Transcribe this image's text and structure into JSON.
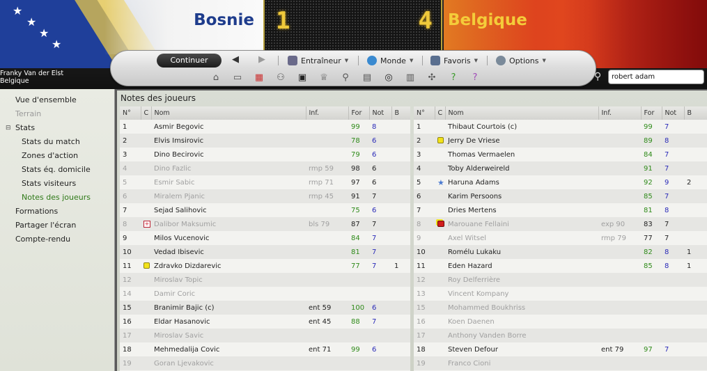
{
  "header": {
    "home_team": "Bosnie",
    "away_team": "Belgique",
    "home_score": "1",
    "away_score": "4",
    "manager_name": "Franky Van der Elst",
    "manager_nation": "Belgique"
  },
  "toolbar": {
    "continue_label": "Continuer",
    "menus": [
      "Entraîneur",
      "Monde",
      "Favoris",
      "Options"
    ],
    "icons": [
      "home-icon",
      "inbox-icon",
      "calendar-icon",
      "squad-icon",
      "tactics-icon",
      "trophy-icon",
      "scouting-icon",
      "notepad-icon",
      "binoculars-icon",
      "news-icon",
      "network-icon",
      "help-icon",
      "question-icon"
    ]
  },
  "search": {
    "value": "robert adam"
  },
  "sidebar": {
    "items": [
      {
        "label": "Vue d'ensemble",
        "level": 1,
        "state": "normal"
      },
      {
        "label": "Terrain",
        "level": 1,
        "state": "disabled"
      },
      {
        "label": "Stats",
        "level": 1,
        "state": "normal",
        "tree": "⊟"
      },
      {
        "label": "Stats du match",
        "level": 2,
        "state": "normal"
      },
      {
        "label": "Zones d'action",
        "level": 2,
        "state": "normal"
      },
      {
        "label": "Stats éq. domicile",
        "level": 2,
        "state": "normal"
      },
      {
        "label": "Stats visiteurs",
        "level": 2,
        "state": "normal"
      },
      {
        "label": "Notes des joueurs",
        "level": 2,
        "state": "active"
      },
      {
        "label": "Formations",
        "level": 1,
        "state": "normal"
      },
      {
        "label": "Partager l'écran",
        "level": 1,
        "state": "normal"
      },
      {
        "label": "Compte-rendu",
        "level": 1,
        "state": "normal"
      }
    ]
  },
  "main": {
    "title": "Notes des joueurs",
    "columns": [
      "N°",
      "C",
      "Nom",
      "Inf.",
      "For",
      "Not",
      "B"
    ],
    "home_players": [
      {
        "no": "1",
        "c": "",
        "name": "Asmir Begovic",
        "inf": "",
        "for": "99",
        "not": "8",
        "b": "",
        "sub": false
      },
      {
        "no": "2",
        "c": "",
        "name": "Elvis Imsirovic",
        "inf": "",
        "for": "78",
        "not": "6",
        "b": "",
        "sub": false
      },
      {
        "no": "3",
        "c": "",
        "name": "Dino Becirovic",
        "inf": "",
        "for": "79",
        "not": "6",
        "b": "",
        "sub": false
      },
      {
        "no": "4",
        "c": "",
        "name": "Dino Fazlic",
        "inf": "rmp 59",
        "for": "98",
        "not": "6",
        "b": "",
        "sub": true
      },
      {
        "no": "5",
        "c": "",
        "name": "Esmir Sabic",
        "inf": "rmp 71",
        "for": "97",
        "not": "6",
        "b": "",
        "sub": true
      },
      {
        "no": "6",
        "c": "",
        "name": "Miralem Pjanic",
        "inf": "rmp 45",
        "for": "91",
        "not": "7",
        "b": "",
        "sub": true
      },
      {
        "no": "7",
        "c": "",
        "name": "Sejad Salihovic",
        "inf": "",
        "for": "75",
        "not": "6",
        "b": "",
        "sub": false
      },
      {
        "no": "8",
        "c": "injury",
        "name": "Dalibor Maksumic",
        "inf": "bls 79",
        "for": "87",
        "not": "7",
        "b": "",
        "sub": true
      },
      {
        "no": "9",
        "c": "",
        "name": "Milos Vucenovic",
        "inf": "",
        "for": "84",
        "not": "7",
        "b": "",
        "sub": false
      },
      {
        "no": "10",
        "c": "",
        "name": "Vedad Ibisevic",
        "inf": "",
        "for": "81",
        "not": "7",
        "b": "",
        "sub": false
      },
      {
        "no": "11",
        "c": "yellow",
        "name": "Zdravko Dizdarevic",
        "inf": "",
        "for": "77",
        "not": "7",
        "b": "1",
        "sub": false
      },
      {
        "no": "12",
        "c": "",
        "name": "Miroslav Topic",
        "inf": "",
        "for": "",
        "not": "",
        "b": "",
        "sub": true
      },
      {
        "no": "14",
        "c": "",
        "name": "Damir Coric",
        "inf": "",
        "for": "",
        "not": "",
        "b": "",
        "sub": true
      },
      {
        "no": "15",
        "c": "",
        "name": "Branimir Bajic (c)",
        "inf": "ent 59",
        "for": "100",
        "not": "6",
        "b": "",
        "sub": false
      },
      {
        "no": "16",
        "c": "",
        "name": "Eldar Hasanovic",
        "inf": "ent 45",
        "for": "88",
        "not": "7",
        "b": "",
        "sub": false
      },
      {
        "no": "17",
        "c": "",
        "name": "Miroslav Savic",
        "inf": "",
        "for": "",
        "not": "",
        "b": "",
        "sub": true
      },
      {
        "no": "18",
        "c": "",
        "name": "Mehmedalija Covic",
        "inf": "ent 71",
        "for": "99",
        "not": "6",
        "b": "",
        "sub": false
      },
      {
        "no": "19",
        "c": "",
        "name": "Goran Ljevakovic",
        "inf": "",
        "for": "",
        "not": "",
        "b": "",
        "sub": true
      }
    ],
    "away_players": [
      {
        "no": "1",
        "c": "",
        "name": "Thibaut Courtois (c)",
        "inf": "",
        "for": "99",
        "not": "7",
        "b": "",
        "sub": false
      },
      {
        "no": "2",
        "c": "yellow",
        "name": "Jerry De Vriese",
        "inf": "",
        "for": "89",
        "not": "8",
        "b": "",
        "sub": false
      },
      {
        "no": "3",
        "c": "",
        "name": "Thomas Vermaelen",
        "inf": "",
        "for": "84",
        "not": "7",
        "b": "",
        "sub": false
      },
      {
        "no": "4",
        "c": "",
        "name": "Toby Alderweireld",
        "inf": "",
        "for": "91",
        "not": "7",
        "b": "",
        "sub": false
      },
      {
        "no": "5",
        "c": "star",
        "name": "Haruna Adams",
        "inf": "",
        "for": "92",
        "not": "9",
        "b": "2",
        "sub": false
      },
      {
        "no": "6",
        "c": "",
        "name": "Karim Persoons",
        "inf": "",
        "for": "85",
        "not": "7",
        "b": "",
        "sub": false
      },
      {
        "no": "7",
        "c": "",
        "name": "Dries Mertens",
        "inf": "",
        "for": "81",
        "not": "8",
        "b": "",
        "sub": false
      },
      {
        "no": "8",
        "c": "red",
        "name": "Marouane Fellaini",
        "inf": "exp 90",
        "for": "83",
        "not": "7",
        "b": "",
        "sub": true
      },
      {
        "no": "9",
        "c": "",
        "name": "Axel Witsel",
        "inf": "rmp 79",
        "for": "77",
        "not": "7",
        "b": "",
        "sub": true
      },
      {
        "no": "10",
        "c": "",
        "name": "Romélu Lukaku",
        "inf": "",
        "for": "82",
        "not": "8",
        "b": "1",
        "sub": false
      },
      {
        "no": "11",
        "c": "",
        "name": "Eden Hazard",
        "inf": "",
        "for": "85",
        "not": "8",
        "b": "1",
        "sub": false
      },
      {
        "no": "12",
        "c": "",
        "name": "Roy Delferrière",
        "inf": "",
        "for": "",
        "not": "",
        "b": "",
        "sub": true
      },
      {
        "no": "13",
        "c": "",
        "name": "Vincent Kompany",
        "inf": "",
        "for": "",
        "not": "",
        "b": "",
        "sub": true
      },
      {
        "no": "15",
        "c": "",
        "name": "Mohammed Boukhriss",
        "inf": "",
        "for": "",
        "not": "",
        "b": "",
        "sub": true
      },
      {
        "no": "16",
        "c": "",
        "name": "Koen Daenen",
        "inf": "",
        "for": "",
        "not": "",
        "b": "",
        "sub": true
      },
      {
        "no": "17",
        "c": "",
        "name": "Anthony Vanden Borre",
        "inf": "",
        "for": "",
        "not": "",
        "b": "",
        "sub": true
      },
      {
        "no": "18",
        "c": "",
        "name": "Steven Defour",
        "inf": "ent 79",
        "for": "97",
        "not": "7",
        "b": "",
        "sub": false
      },
      {
        "no": "19",
        "c": "",
        "name": "Franco Cioni",
        "inf": "",
        "for": "",
        "not": "",
        "b": "",
        "sub": true
      }
    ]
  }
}
